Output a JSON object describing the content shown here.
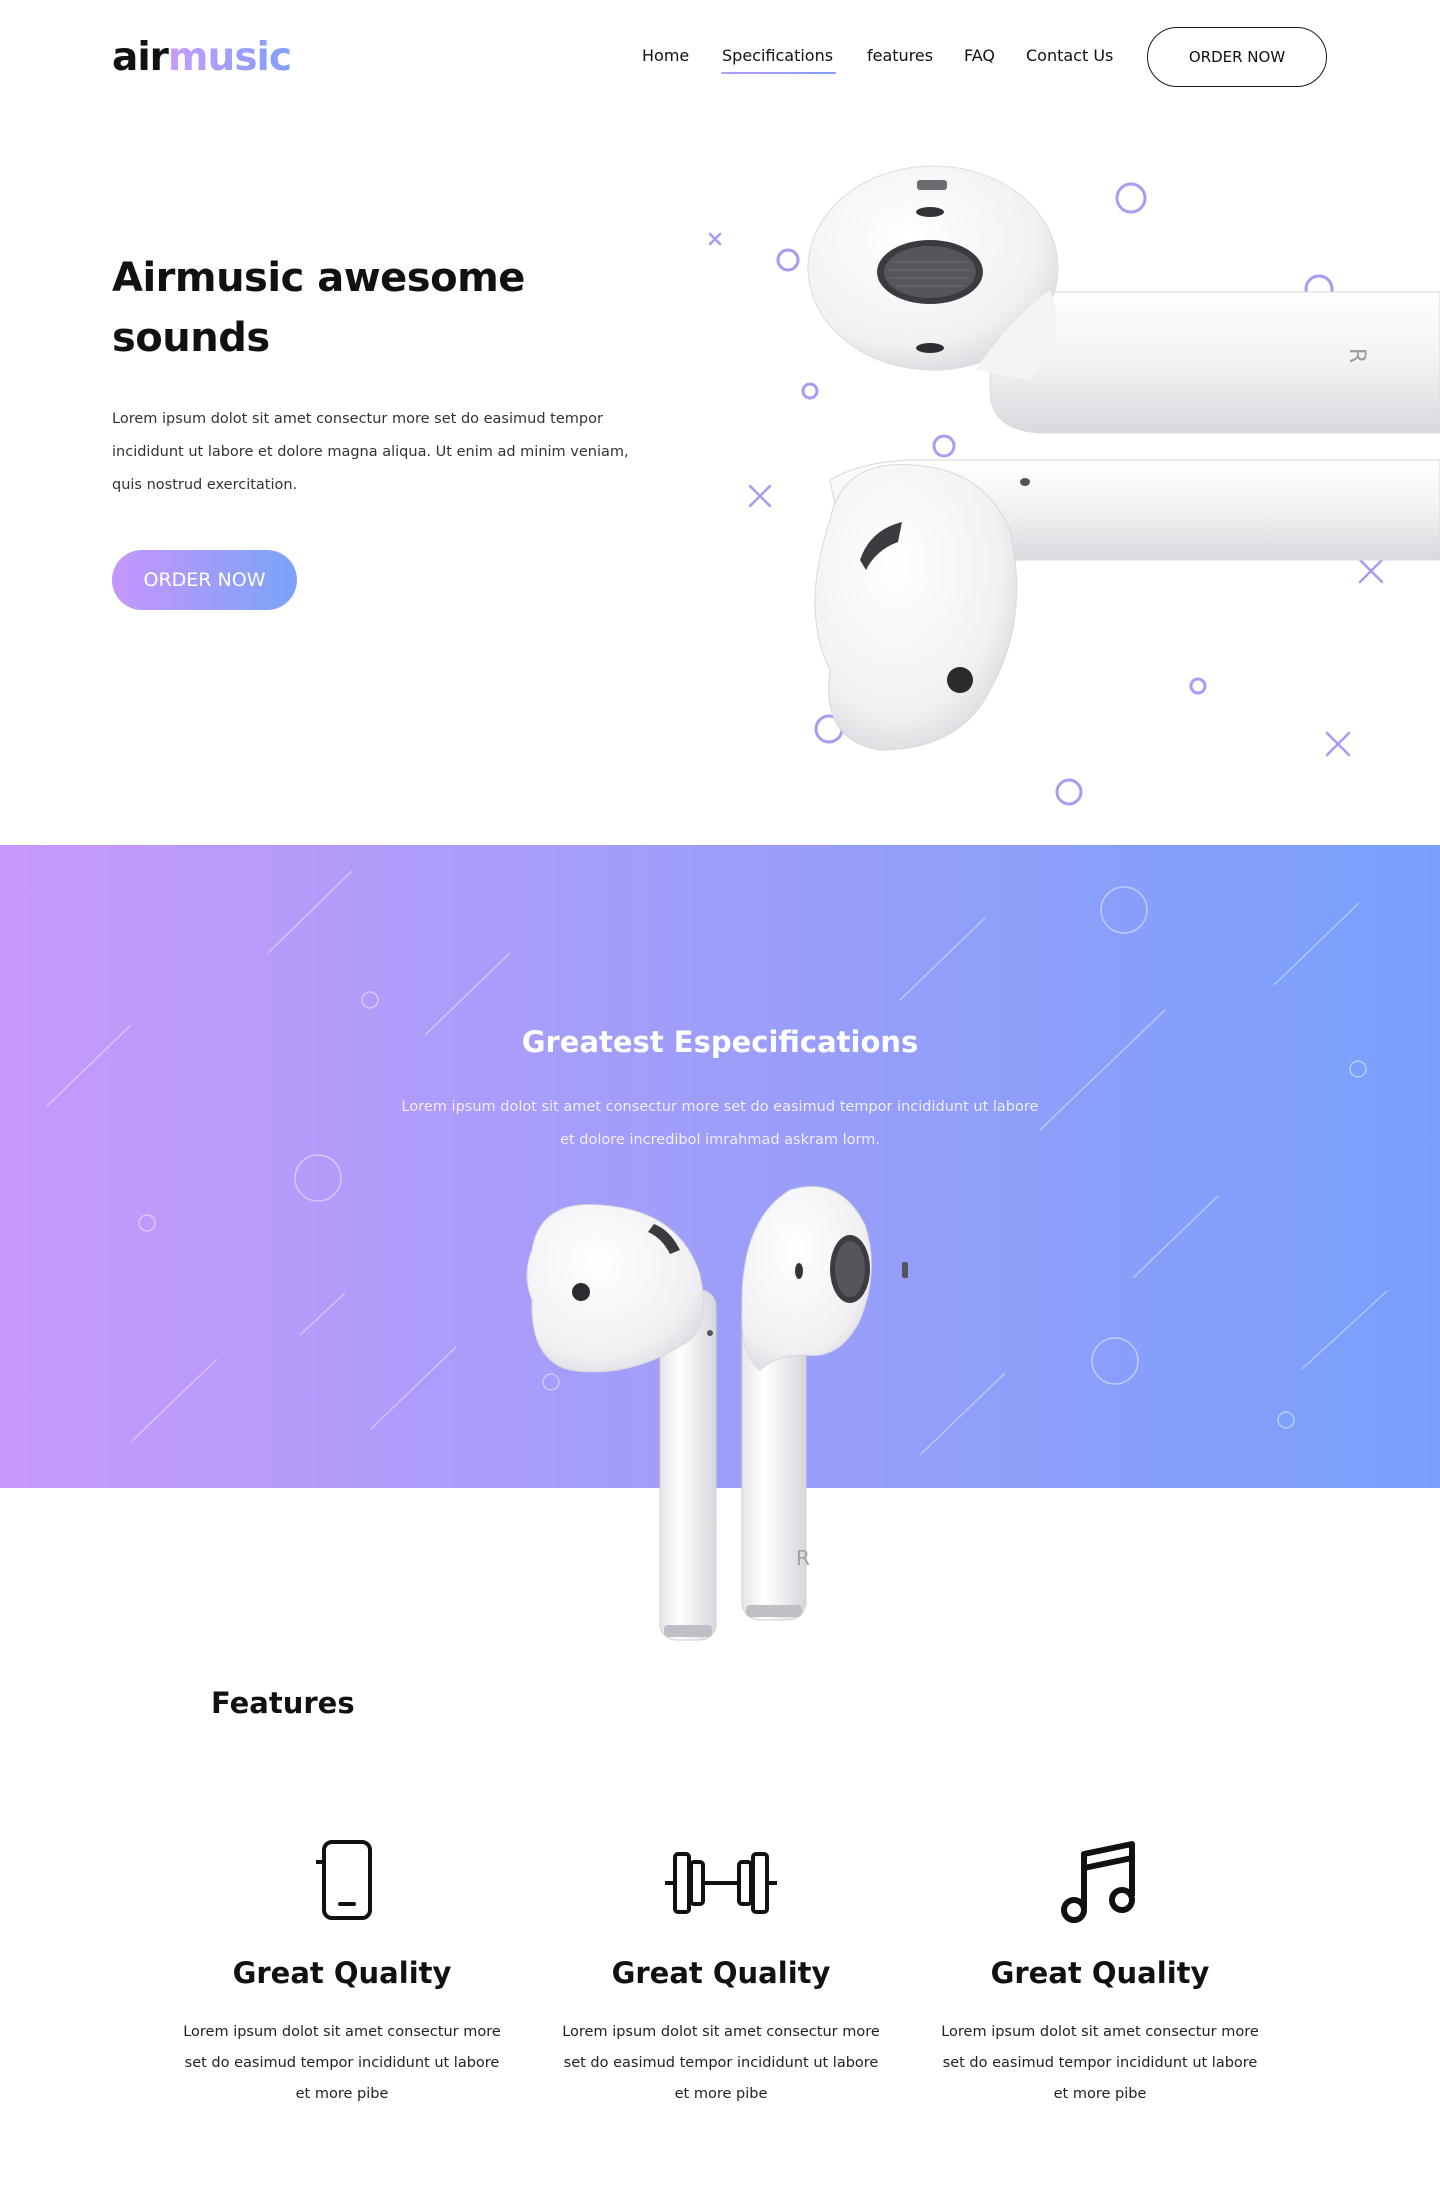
{
  "header": {
    "logo": {
      "part1": "air",
      "part2": "music"
    },
    "nav": [
      "Home",
      "Specifications",
      "features",
      "FAQ",
      "Contact Us"
    ],
    "active_nav": "Specifications",
    "order_button": "ORDER NOW"
  },
  "hero": {
    "title": "Airmusic awesome sounds",
    "description": "Lorem ipsum dolot sit amet consectur more set do easimud tempor incididunt ut labore et dolore magna aliqua. Ut enim ad minim veniam, quis nostrud exercitation.",
    "button": "ORDER NOW",
    "image": "airpods-horizontal"
  },
  "specifications": {
    "title": "Greatest Especifications",
    "description": "Lorem ipsum dolot sit amet consectur more set do easimud tempor incididunt ut labore et dolore incredibol imrahmad askram lorm.",
    "image": "airpods-vertical"
  },
  "features": {
    "title": "Features",
    "items": [
      {
        "icon": "phone-icon",
        "title": "Great Quality",
        "description": "Lorem ipsum dolot sit amet consectur more set do easimud tempor incididunt ut labore et more pibe"
      },
      {
        "icon": "dumbbell-icon",
        "title": "Great Quality",
        "description": "Lorem ipsum dolot sit amet consectur more set do easimud tempor incididunt ut labore et more pibe"
      },
      {
        "icon": "music-note-icon",
        "title": "Great Quality",
        "description": "Lorem ipsum dolot sit amet consectur more set do easimud tempor incididunt ut labore et more pibe"
      }
    ]
  },
  "colors": {
    "gradient_start": "#c799fb",
    "gradient_end": "#78a0fb",
    "text": "#111111",
    "background": "#ffffff"
  }
}
